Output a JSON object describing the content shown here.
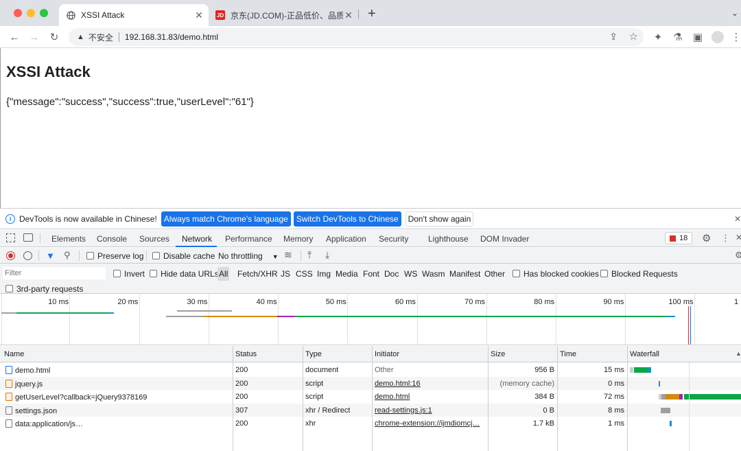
{
  "browser": {
    "tabs": [
      {
        "title": "XSSI Attack",
        "active": true,
        "favicon": "globe-icon"
      },
      {
        "title": "京东(JD.COM)-正品低价、品质",
        "active": false,
        "favicon": "jd-icon",
        "favicon_text": "JD"
      }
    ],
    "new_tab_label": "+",
    "omnibox": {
      "security_label": "不安全",
      "url": "192.168.31.83/demo.html"
    }
  },
  "page": {
    "heading": "XSSI Attack",
    "body_text": "{\"message\":\"success\",\"success\":true,\"userLevel\":\"61\"}"
  },
  "devtools": {
    "infobar": {
      "message": "DevTools is now available in Chinese!",
      "btn_match": "Always match Chrome's language",
      "btn_switch": "Switch DevTools to Chinese",
      "btn_dont_show": "Don't show again"
    },
    "panel_tabs": [
      "Elements",
      "Console",
      "Sources",
      "Network",
      "Performance",
      "Memory",
      "Application",
      "Security",
      "Lighthouse",
      "DOM Invader"
    ],
    "active_panel": "Network",
    "issues_count": "18",
    "network_toolbar": {
      "preserve_log": "Preserve log",
      "disable_cache": "Disable cache",
      "throttling": "No throttling"
    },
    "filter": {
      "placeholder": "Filter",
      "invert": "Invert",
      "hide_data_urls": "Hide data URLs",
      "types": [
        "All",
        "Fetch/XHR",
        "JS",
        "CSS",
        "Img",
        "Media",
        "Font",
        "Doc",
        "WS",
        "Wasm",
        "Manifest",
        "Other"
      ],
      "has_blocked_cookies": "Has blocked cookies",
      "blocked_requests": "Blocked Requests",
      "third_party": "3rd-party requests"
    },
    "overview_ticks": [
      "10 ms",
      "20 ms",
      "30 ms",
      "40 ms",
      "50 ms",
      "60 ms",
      "70 ms",
      "80 ms",
      "90 ms",
      "100 ms",
      "1"
    ],
    "columns": [
      "Name",
      "Status",
      "Type",
      "Initiator",
      "Size",
      "Time",
      "Waterfall"
    ],
    "requests": [
      {
        "name": "demo.html",
        "status": "200",
        "type": "document",
        "initiator": "Other",
        "initiator_link": false,
        "size": "956 B",
        "time": "15 ms",
        "icon": "document-icon",
        "icon_color": "#1a73e8"
      },
      {
        "name": "jquery.js",
        "status": "200",
        "type": "script",
        "initiator": "demo.html:16",
        "initiator_link": true,
        "size": "(memory cache)",
        "time": "0 ms",
        "icon": "script-icon",
        "icon_color": "#e8710a"
      },
      {
        "name": "getUserLevel?callback=jQuery9378169",
        "status": "200",
        "type": "script",
        "initiator": "demo.html",
        "initiator_link": true,
        "size": "384 B",
        "time": "72 ms",
        "icon": "script-icon",
        "icon_color": "#e8710a"
      },
      {
        "name": "settings.json",
        "status": "307",
        "type": "xhr / Redirect",
        "initiator": "read-settings.js:1",
        "initiator_link": true,
        "size": "0 B",
        "time": "8 ms",
        "icon": "file-icon",
        "icon_color": "#777777"
      },
      {
        "name": "data:application/js…",
        "status": "200",
        "type": "xhr",
        "initiator": "chrome-extension://ijmdiomcj…",
        "initiator_link": true,
        "size": "1.7 kB",
        "time": "1 ms",
        "icon": "file-icon",
        "icon_color": "#777777"
      }
    ]
  },
  "colors": {
    "accent_blue": "#1a73e8",
    "waterfall_green": "#0ca648",
    "waterfall_orange": "#d48a0c",
    "waterfall_blue": "#1a8cd8",
    "waterfall_purple": "#9c27b0",
    "record_red": "#d93025"
  }
}
